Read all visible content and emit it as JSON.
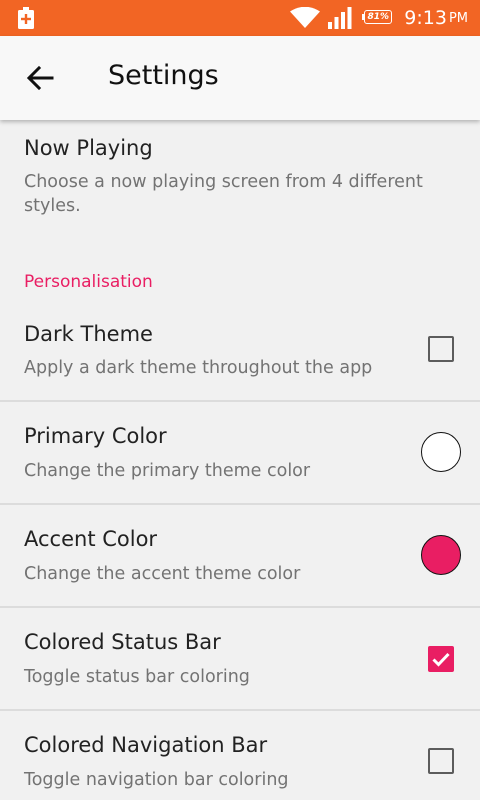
{
  "status_bar": {
    "time": "9:13",
    "ampm": "PM",
    "battery_percent": "81%",
    "color": "#f26524",
    "icons": [
      "battery-charging-icon",
      "wifi-icon",
      "signal-icon",
      "battery-icon"
    ]
  },
  "appbar": {
    "title": "Settings",
    "back_icon": "arrow-back-icon"
  },
  "now_playing": {
    "title": "Now Playing",
    "summary": "Choose a now playing screen from 4 different styles."
  },
  "personalisation": {
    "header": "Personalisation",
    "header_color": "#e91e63",
    "items": [
      {
        "title": "Dark Theme",
        "summary": "Apply a dark theme throughout the app",
        "widget": "checkbox",
        "checked": false
      },
      {
        "title": "Primary Color",
        "summary": "Change the primary theme color",
        "widget": "color-swatch",
        "color": "#ffffff"
      },
      {
        "title": "Accent Color",
        "summary": "Change the accent theme color",
        "widget": "color-swatch",
        "color": "#e91e63"
      },
      {
        "title": "Colored Status Bar",
        "summary": "Toggle status bar coloring",
        "widget": "checkbox",
        "checked": true
      },
      {
        "title": "Colored Navigation Bar",
        "summary": "Toggle navigation bar coloring",
        "widget": "checkbox",
        "checked": false
      }
    ]
  }
}
